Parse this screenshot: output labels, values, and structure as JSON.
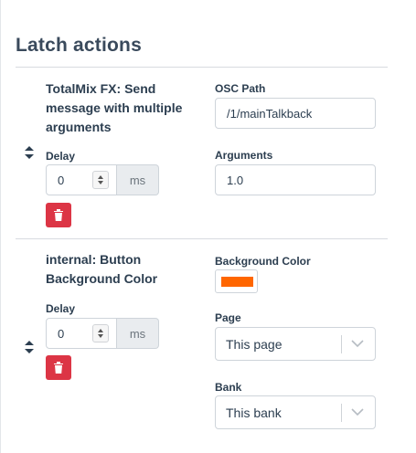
{
  "section": {
    "title": "Latch actions"
  },
  "actions": [
    {
      "title": "TotalMix FX: Send message with multiple arguments",
      "title_lines": [
        "TotalMix FX: Send",
        "message with multiple",
        "arguments"
      ],
      "delay": {
        "label": "Delay",
        "value": "0",
        "unit": "ms"
      },
      "options": {
        "osc_path": {
          "label": "OSC Path",
          "value": "/1/mainTalkback"
        },
        "arguments": {
          "label": "Arguments",
          "value": "1.0"
        }
      }
    },
    {
      "title": "internal: Button Background Color",
      "title_lines": [
        "internal: Button",
        "Background Color"
      ],
      "delay": {
        "label": "Delay",
        "value": "0",
        "unit": "ms"
      },
      "options": {
        "background_color": {
          "label": "Background Color",
          "color": "#ff6600"
        },
        "page": {
          "label": "Page",
          "value": "This page"
        },
        "bank": {
          "label": "Bank",
          "value": "This bank"
        }
      }
    }
  ],
  "icons": {
    "sort": "sort-handle-icon",
    "delete": "trash-icon",
    "spinner": "number-spinner-icon",
    "dropdown": "chevron-down-icon"
  },
  "colors": {
    "delete": "#dc3545",
    "text": "#2c3e50",
    "addon": "#e9ecef"
  }
}
